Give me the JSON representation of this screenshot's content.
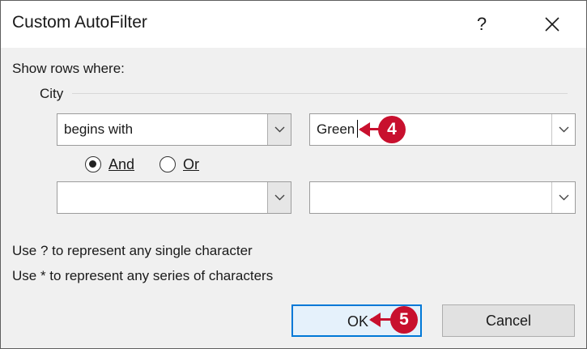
{
  "window": {
    "title": "Custom AutoFilter",
    "help_label": "?",
    "close_label": "✕"
  },
  "prompt": "Show rows where:",
  "field_name": "City",
  "criteria1": {
    "operator": "begins with",
    "value": "Green"
  },
  "logic": {
    "and_label": "And",
    "or_label": "Or",
    "selected": "And"
  },
  "criteria2": {
    "operator": "",
    "value": ""
  },
  "hints": [
    "Use ? to represent any single character",
    "Use * to represent any series of characters"
  ],
  "buttons": {
    "ok": "OK",
    "cancel": "Cancel"
  },
  "callouts": {
    "step_value": "4",
    "step_ok": "5"
  },
  "colors": {
    "callout": "#c8102e",
    "default_button_border": "#0078d7"
  }
}
